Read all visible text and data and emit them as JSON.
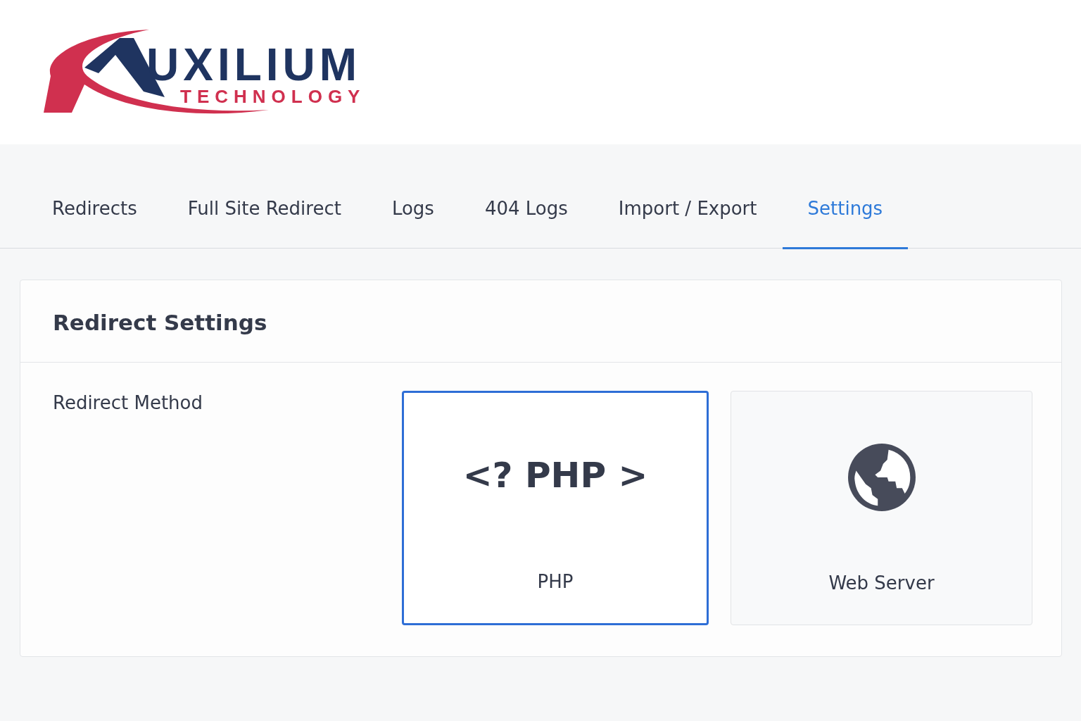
{
  "logo": {
    "wordmark": "UXILIUM",
    "tagline": "TECHNOLOGY"
  },
  "tabs": [
    {
      "label": "Redirects",
      "selected": false
    },
    {
      "label": "Full Site Redirect",
      "selected": false
    },
    {
      "label": "Logs",
      "selected": false
    },
    {
      "label": "404 Logs",
      "selected": false
    },
    {
      "label": "Import / Export",
      "selected": false
    },
    {
      "label": "Settings",
      "selected": true
    }
  ],
  "card": {
    "title": "Redirect Settings",
    "field_label": "Redirect Method",
    "options": [
      {
        "kind": "code",
        "code_text": "<? PHP >",
        "label": "PHP",
        "selected": true
      },
      {
        "kind": "globe",
        "label": "Web Server",
        "selected": false
      }
    ]
  }
}
